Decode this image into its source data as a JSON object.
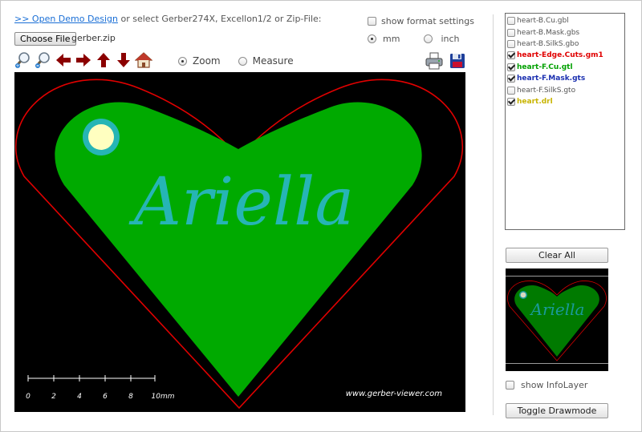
{
  "header": {
    "demo_link": ">> Open Demo Design",
    "demo_text": " or select Gerber274X, Excellon1/2 or Zip-File:",
    "choose_file_label": "Choose File",
    "file_name": "gerber.zip",
    "show_format_settings": "show format settings",
    "unit_mm": "mm",
    "unit_inch": "inch",
    "unit_selected": "mm"
  },
  "toolbar": {
    "tools": [
      "zoom-in-icon",
      "zoom-out-icon",
      "arrow-left-icon",
      "arrow-right-icon",
      "arrow-up-icon",
      "arrow-down-icon",
      "home-icon"
    ],
    "mode_zoom": "Zoom",
    "mode_measure": "Measure",
    "mode_selected": "Zoom"
  },
  "canvas": {
    "board_text": "Ariella",
    "watermark": "www.gerber-viewer.com",
    "scale_labels": [
      "0",
      "2",
      "4",
      "6",
      "8",
      "10mm"
    ],
    "colors": {
      "background": "#000000",
      "copper": "#00aa00",
      "mask": "#26b5b5",
      "edge": "#e00000",
      "drill": "#ffffc0"
    }
  },
  "layers": [
    {
      "name": "heart-B.Cu.gbl",
      "checked": false,
      "color": "#555555",
      "bold": false
    },
    {
      "name": "heart-B.Mask.gbs",
      "checked": false,
      "color": "#555555",
      "bold": false
    },
    {
      "name": "heart-B.SilkS.gbo",
      "checked": false,
      "color": "#555555",
      "bold": false
    },
    {
      "name": "heart-Edge.Cuts.gm1",
      "checked": true,
      "color": "#e00000",
      "bold": true
    },
    {
      "name": "heart-F.Cu.gtl",
      "checked": true,
      "color": "#00a000",
      "bold": true
    },
    {
      "name": "heart-F.Mask.gts",
      "checked": true,
      "color": "#1a2fb0",
      "bold": true
    },
    {
      "name": "heart-F.SilkS.gto",
      "checked": false,
      "color": "#555555",
      "bold": false
    },
    {
      "name": "heart.drl",
      "checked": true,
      "color": "#c8b400",
      "bold": true
    }
  ],
  "sidebar": {
    "clear_all": "Clear All",
    "show_infolayer": "show InfoLayer",
    "toggle_drawmode": "Toggle Drawmode"
  }
}
